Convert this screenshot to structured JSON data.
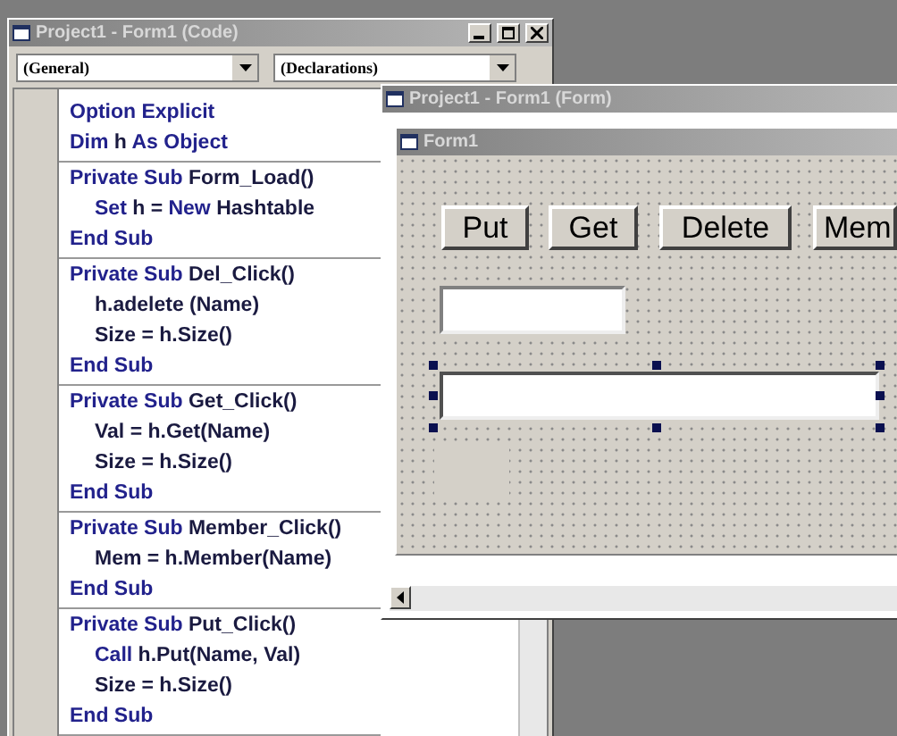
{
  "code_window": {
    "title": "Project1 - Form1 (Code)",
    "object_combo": "(General)",
    "procedure_combo": "(Declarations)",
    "blocks": [
      [
        {
          "indented": false,
          "tokens": [
            {
              "text": "Option Explicit",
              "kind": "keyword"
            }
          ]
        },
        {
          "indented": false,
          "tokens": [
            {
              "text": "Dim",
              "kind": "keyword"
            },
            {
              "text": " h ",
              "kind": "plain"
            },
            {
              "text": "As Object",
              "kind": "keyword"
            }
          ]
        }
      ],
      [
        {
          "indented": false,
          "tokens": [
            {
              "text": "Private Sub",
              "kind": "keyword"
            },
            {
              "text": " Form_Load()",
              "kind": "plain"
            }
          ]
        },
        {
          "indented": true,
          "tokens": [
            {
              "text": "Set",
              "kind": "keyword"
            },
            {
              "text": " h = ",
              "kind": "plain"
            },
            {
              "text": "New",
              "kind": "keyword"
            },
            {
              "text": " Hashtable",
              "kind": "plain"
            }
          ]
        },
        {
          "indented": false,
          "tokens": [
            {
              "text": "End Sub",
              "kind": "keyword"
            }
          ]
        }
      ],
      [
        {
          "indented": false,
          "tokens": [
            {
              "text": "Private Sub",
              "kind": "keyword"
            },
            {
              "text": " Del_Click()",
              "kind": "plain"
            }
          ]
        },
        {
          "indented": true,
          "tokens": [
            {
              "text": "h.adelete (Name)",
              "kind": "plain"
            }
          ]
        },
        {
          "indented": true,
          "tokens": [
            {
              "text": "Size = h.Size()",
              "kind": "plain"
            }
          ]
        },
        {
          "indented": false,
          "tokens": [
            {
              "text": "End Sub",
              "kind": "keyword"
            }
          ]
        }
      ],
      [
        {
          "indented": false,
          "tokens": [
            {
              "text": "Private Sub",
              "kind": "keyword"
            },
            {
              "text": " Get_Click()",
              "kind": "plain"
            }
          ]
        },
        {
          "indented": true,
          "tokens": [
            {
              "text": "Val = h.Get(Name)",
              "kind": "plain"
            }
          ]
        },
        {
          "indented": true,
          "tokens": [
            {
              "text": "Size = h.Size()",
              "kind": "plain"
            }
          ]
        },
        {
          "indented": false,
          "tokens": [
            {
              "text": "End Sub",
              "kind": "keyword"
            }
          ]
        }
      ],
      [
        {
          "indented": false,
          "tokens": [
            {
              "text": "Private Sub",
              "kind": "keyword"
            },
            {
              "text": " Member_Click()",
              "kind": "plain"
            }
          ]
        },
        {
          "indented": true,
          "tokens": [
            {
              "text": "Mem = h.Member(Name)",
              "kind": "plain"
            }
          ]
        },
        {
          "indented": false,
          "tokens": [
            {
              "text": "End Sub",
              "kind": "keyword"
            }
          ]
        }
      ],
      [
        {
          "indented": false,
          "tokens": [
            {
              "text": "Private Sub",
              "kind": "keyword"
            },
            {
              "text": " Put_Click()",
              "kind": "plain"
            }
          ]
        },
        {
          "indented": true,
          "tokens": [
            {
              "text": "Call",
              "kind": "keyword"
            },
            {
              "text": " h.Put(Name, Val)",
              "kind": "plain"
            }
          ]
        },
        {
          "indented": true,
          "tokens": [
            {
              "text": "Size = h.Size()",
              "kind": "plain"
            }
          ]
        },
        {
          "indented": false,
          "tokens": [
            {
              "text": "End Sub",
              "kind": "keyword"
            }
          ]
        }
      ]
    ]
  },
  "form_window": {
    "title": "Project1 - Form1 (Form)",
    "form_title": "Form1",
    "controls": [
      {
        "kind": "button",
        "caption": "Put",
        "selected": false
      },
      {
        "kind": "button",
        "caption": "Get",
        "selected": false
      },
      {
        "kind": "button",
        "caption": "Delete",
        "selected": false
      },
      {
        "kind": "button",
        "caption": "Mem",
        "selected": false
      },
      {
        "kind": "textbox",
        "selected": false
      },
      {
        "kind": "textbox",
        "selected": true
      },
      {
        "kind": "label",
        "selected": false
      }
    ]
  }
}
